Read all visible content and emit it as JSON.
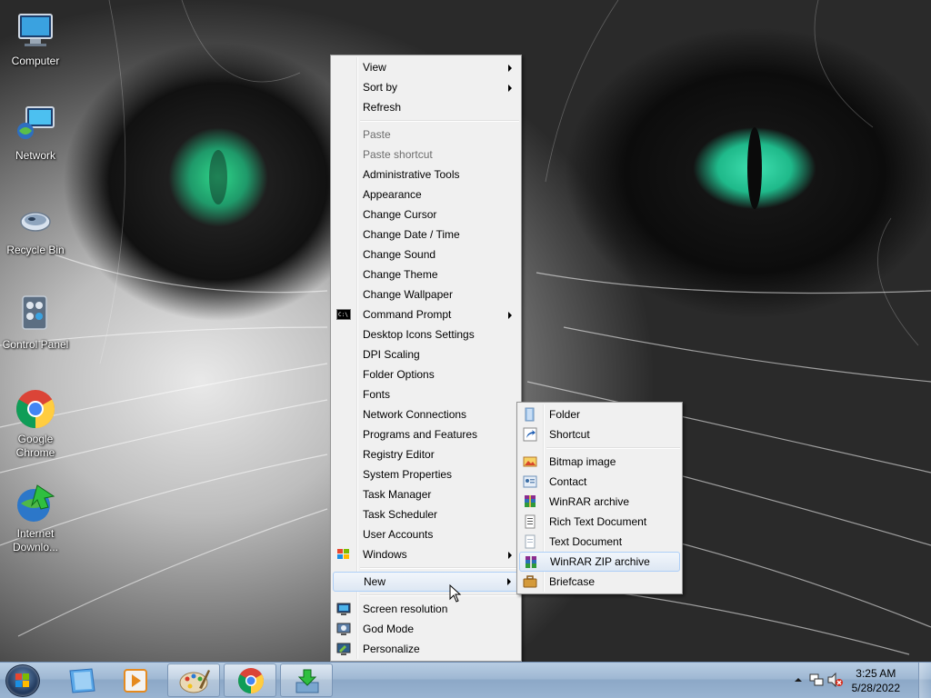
{
  "desktop_icons": [
    {
      "label": "Computer",
      "icon": "computer-icon"
    },
    {
      "label": "Network",
      "icon": "network-icon"
    },
    {
      "label": "Recycle Bin",
      "icon": "recycle-bin-icon"
    },
    {
      "label": "Control Panel",
      "icon": "control-panel-icon"
    },
    {
      "label": "Google Chrome",
      "icon": "chrome-icon"
    },
    {
      "label": "Internet Downlo...",
      "icon": "internet-download-manager-icon"
    }
  ],
  "context_menu": {
    "view": "View",
    "sort_by": "Sort by",
    "refresh": "Refresh",
    "paste": "Paste",
    "paste_shortcut": "Paste shortcut",
    "administrative_tools": "Administrative Tools",
    "appearance": "Appearance",
    "change_cursor": "Change Cursor",
    "change_date_time": "Change Date / Time",
    "change_sound": "Change Sound",
    "change_theme": "Change Theme",
    "change_wallpaper": "Change Wallpaper",
    "command_prompt": "Command Prompt",
    "desktop_icons_settings": "Desktop Icons Settings",
    "dpi_scaling": "DPI Scaling",
    "folder_options": "Folder Options",
    "fonts": "Fonts",
    "network_connections": "Network Connections",
    "programs_and_features": "Programs and Features",
    "registry_editor": "Registry Editor",
    "system_properties": "System Properties",
    "task_manager": "Task Manager",
    "task_scheduler": "Task Scheduler",
    "user_accounts": "User Accounts",
    "windows": "Windows",
    "new": "New",
    "screen_resolution": "Screen resolution",
    "god_mode": "God Mode",
    "personalize": "Personalize"
  },
  "new_submenu": {
    "folder": "Folder",
    "shortcut": "Shortcut",
    "bitmap_image": "Bitmap image",
    "contact": "Contact",
    "winrar_archive": "WinRAR archive",
    "rich_text_document": "Rich Text Document",
    "text_document": "Text Document",
    "winrar_zip_archive": "WinRAR ZIP archive",
    "briefcase": "Briefcase"
  },
  "taskbar": {
    "pinned": [
      "file-explorer-icon",
      "media-player-icon",
      "paint-icon",
      "chrome-icon",
      "download-manager-icon"
    ],
    "time": "3:25 AM",
    "date": "5/28/2022"
  },
  "colors": {
    "menu_bg": "#f0f0f0",
    "menu_hover": "#dde7f3",
    "taskbar": "#9fb8d3",
    "eye_green": "#2fd68a"
  }
}
